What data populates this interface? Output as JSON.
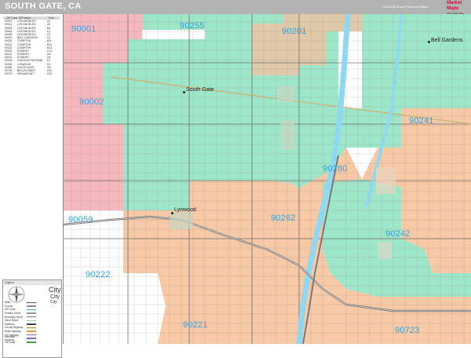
{
  "header": {
    "title": "SOUTH GATE, CA",
    "edition": "2023 ZIP Code Premium Edition",
    "brand_name": "Market Maps",
    "brand_sub": "ZIP CODE WALL MAP"
  },
  "colors": {
    "zip_green": "#9ee6c9",
    "zip_orange": "#f7c9a6",
    "zip_pink": "#f4b8bd",
    "zip_tan": "#e0c9a8",
    "zip_white": "#ffffff",
    "zip_label": "#3aa0d8",
    "river": "#8fd8f0",
    "street": "#8a8a8a"
  },
  "zip_table": {
    "header": [
      "ZIP Code",
      "ZIP Name",
      "Grid"
    ],
    "rows": [
      [
        "90001",
        "LOS ANGELES",
        "A1"
      ],
      [
        "90002",
        "LOS ANGELES",
        "A3"
      ],
      [
        "90003",
        "LOS ANGELES",
        "B4"
      ],
      [
        "90044",
        "LOS ANGELES",
        "C1"
      ],
      [
        "90059",
        "LOS ANGELES",
        "C3"
      ],
      [
        "90201",
        "BELL GARDENS",
        "D1"
      ],
      [
        "90220",
        "COMPTON",
        "B11"
      ],
      [
        "90221",
        "COMPTON",
        "B12"
      ],
      [
        "90222",
        "COMPTON",
        "B13"
      ],
      [
        "90240",
        "DOWNEY",
        "C14"
      ],
      [
        "90241",
        "DOWNEY",
        "D6"
      ],
      [
        "90242",
        "DOWNEY",
        "D8"
      ],
      [
        "90255",
        "HUNTINGTON PARK",
        "E1"
      ],
      [
        "90262",
        "LYNWOOD",
        "E4"
      ],
      [
        "90280",
        "SOUTH GATE",
        "G8"
      ],
      [
        "90706",
        "BELLFLOWER",
        "H11"
      ],
      [
        "90723",
        "PARAMOUNT",
        "H13"
      ]
    ]
  },
  "legend": {
    "title": "Legend",
    "city_big": "City",
    "city_mid": "City",
    "city_small": "City",
    "items": [
      {
        "name": "State",
        "color": "#555555"
      },
      {
        "name": "County",
        "color": "#888888"
      },
      {
        "name": "ZIP Code",
        "color": "#3aa0d8"
      },
      {
        "name": "Primary Street",
        "color": "#999999"
      },
      {
        "name": "Boundary Street",
        "color": "#777777"
      },
      {
        "name": "Minor Street",
        "color": "#bbbbbb"
      },
      {
        "name": "Railroad",
        "color": "#444444"
      },
      {
        "name": "County Highway",
        "color": "#c87d2a"
      },
      {
        "name": "State Highway",
        "color": "#d9a33a"
      },
      {
        "name": "US Highway",
        "color": "#b85b8f"
      },
      {
        "name": "Interstate Highway",
        "color": "#7a6fb8"
      },
      {
        "name": "Toll Road",
        "color": "#4a9a4a"
      }
    ]
  },
  "zip_labels": [
    {
      "text": "90001"
    },
    {
      "text": "90255"
    },
    {
      "text": "90201"
    },
    {
      "text": "90002"
    },
    {
      "text": "90241"
    },
    {
      "text": "90280"
    },
    {
      "text": "90262"
    },
    {
      "text": "90059"
    },
    {
      "text": "90242"
    },
    {
      "text": "90222"
    },
    {
      "text": "90221"
    },
    {
      "text": "90723"
    }
  ],
  "cities": {
    "south_gate": "South Gate",
    "lynwood": "Lynwood",
    "bell_gardens": "Bell Gardens"
  }
}
